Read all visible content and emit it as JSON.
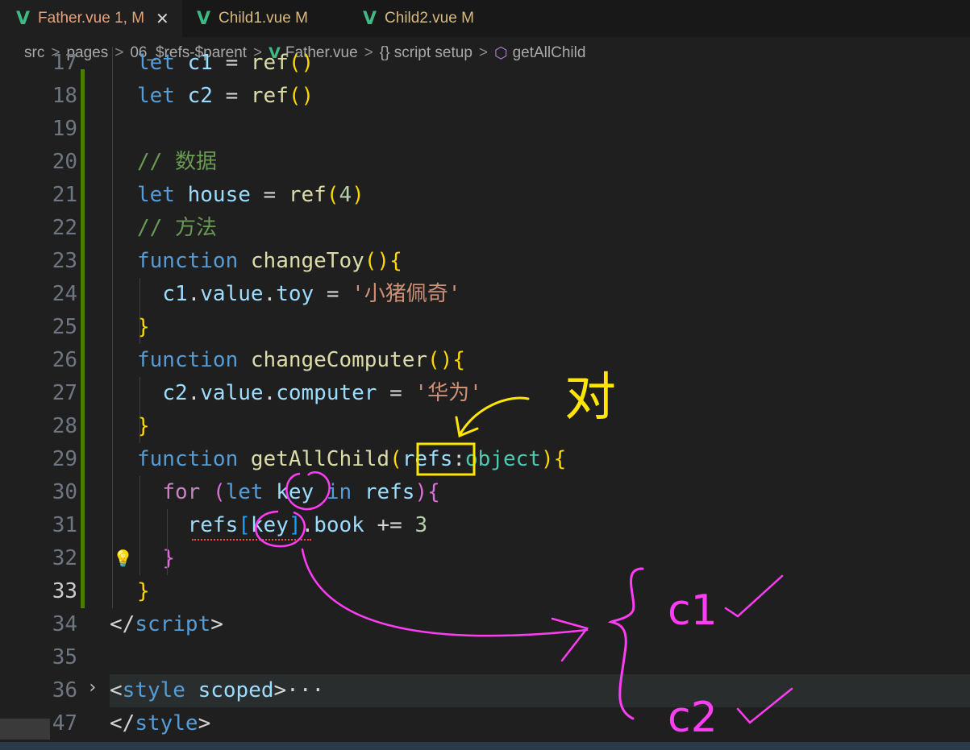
{
  "tabs": [
    {
      "label": "Father.vue 1, M",
      "active": true,
      "close": "✕"
    },
    {
      "label": "Child1.vue M"
    },
    {
      "label": "Child2.vue M"
    }
  ],
  "breadcrumb": {
    "src": "src",
    "pages": "pages",
    "folder": "06_$refs-$parent",
    "file": "Father.vue",
    "section": "{} script setup",
    "symbol": "getAllChild"
  },
  "editor": {
    "lines": [
      {
        "n": "17",
        "parts": [
          [
            "kw",
            "let"
          ],
          [
            "pun",
            " "
          ],
          [
            "var",
            "c1"
          ],
          [
            "pun",
            " = "
          ],
          [
            "fn",
            "ref"
          ],
          [
            "br1",
            "()"
          ]
        ]
      },
      {
        "n": "18",
        "parts": [
          [
            "kw",
            "let"
          ],
          [
            "pun",
            " "
          ],
          [
            "var",
            "c2"
          ],
          [
            "pun",
            " = "
          ],
          [
            "fn",
            "ref"
          ],
          [
            "br1",
            "()"
          ]
        ]
      },
      {
        "n": "19",
        "parts": []
      },
      {
        "n": "20",
        "parts": [
          [
            "cmt",
            "// 数据"
          ]
        ]
      },
      {
        "n": "21",
        "parts": [
          [
            "kw",
            "let"
          ],
          [
            "pun",
            " "
          ],
          [
            "var",
            "house"
          ],
          [
            "pun",
            " = "
          ],
          [
            "fn",
            "ref"
          ],
          [
            "br1",
            "("
          ],
          [
            "num",
            "4"
          ],
          [
            "br1",
            ")"
          ]
        ]
      },
      {
        "n": "22",
        "parts": [
          [
            "cmt",
            "// 方法"
          ]
        ]
      },
      {
        "n": "23",
        "parts": [
          [
            "kw",
            "function"
          ],
          [
            "pun",
            " "
          ],
          [
            "fn",
            "changeToy"
          ],
          [
            "br1",
            "(){"
          ]
        ]
      },
      {
        "n": "24",
        "parts": [
          [
            "pun",
            "  "
          ],
          [
            "var",
            "c1"
          ],
          [
            "pun",
            "."
          ],
          [
            "var",
            "value"
          ],
          [
            "pun",
            "."
          ],
          [
            "var",
            "toy"
          ],
          [
            "pun",
            " = "
          ],
          [
            "str",
            "'小猪佩奇'"
          ]
        ]
      },
      {
        "n": "25",
        "parts": [
          [
            "br1",
            "}"
          ]
        ]
      },
      {
        "n": "26",
        "parts": [
          [
            "kw",
            "function"
          ],
          [
            "pun",
            " "
          ],
          [
            "fn",
            "changeComputer"
          ],
          [
            "br1",
            "(){"
          ]
        ]
      },
      {
        "n": "27",
        "parts": [
          [
            "pun",
            "  "
          ],
          [
            "var",
            "c2"
          ],
          [
            "pun",
            "."
          ],
          [
            "var",
            "value"
          ],
          [
            "pun",
            "."
          ],
          [
            "var",
            "computer"
          ],
          [
            "pun",
            " = "
          ],
          [
            "str",
            "'华为'"
          ]
        ]
      },
      {
        "n": "28",
        "parts": [
          [
            "br1",
            "}"
          ]
        ]
      },
      {
        "n": "29",
        "parts": [
          [
            "kw",
            "function"
          ],
          [
            "pun",
            " "
          ],
          [
            "fn",
            "getAllChild"
          ],
          [
            "br1",
            "("
          ],
          [
            "var",
            "refs"
          ],
          [
            "pun",
            ":"
          ],
          [
            "ty",
            "object"
          ],
          [
            "br1",
            ")"
          ],
          [
            "br1",
            "{"
          ]
        ]
      },
      {
        "n": "30",
        "parts": [
          [
            "pun",
            "  "
          ],
          [
            "ctrl",
            "for"
          ],
          [
            "pun",
            " "
          ],
          [
            "br2",
            "("
          ],
          [
            "kw",
            "let"
          ],
          [
            "pun",
            " "
          ],
          [
            "var",
            "key"
          ],
          [
            "pun",
            " "
          ],
          [
            "kw",
            "in"
          ],
          [
            "pun",
            " "
          ],
          [
            "var",
            "refs"
          ],
          [
            "br2",
            ")"
          ],
          [
            "br2",
            "{"
          ]
        ]
      },
      {
        "n": "31",
        "parts": [
          [
            "pun",
            "    "
          ],
          [
            "var",
            "refs"
          ],
          [
            "br3",
            "["
          ],
          [
            "var",
            "key"
          ],
          [
            "br3",
            "]"
          ],
          [
            "pun",
            "."
          ],
          [
            "var",
            "book"
          ],
          [
            "pun",
            " += "
          ],
          [
            "num",
            "3"
          ]
        ]
      },
      {
        "n": "32",
        "parts": [
          [
            "pun",
            "  "
          ],
          [
            "br2",
            "}"
          ]
        ]
      },
      {
        "n": "33",
        "parts": [
          [
            "br1",
            "}"
          ]
        ],
        "current": true
      },
      {
        "n": "34",
        "parts": [
          [
            "pun",
            "</"
          ],
          [
            "kw",
            "script"
          ],
          [
            "pun",
            ">"
          ]
        ],
        "nomargin": true
      },
      {
        "n": "35",
        "parts": []
      },
      {
        "n": "36",
        "parts": [
          [
            "pun",
            "<"
          ],
          [
            "kw",
            "style"
          ],
          [
            "pun",
            " "
          ],
          [
            "var",
            "scoped"
          ],
          [
            "pun",
            ">"
          ],
          [
            "pun",
            "···"
          ]
        ],
        "nomargin": true,
        "folded": true
      },
      {
        "n": "47",
        "parts": [
          [
            "pun",
            "</"
          ],
          [
            "kw",
            "style"
          ],
          [
            "pun",
            ">"
          ]
        ],
        "nomargin": true
      }
    ]
  },
  "annotations": {
    "label_dui": "对",
    "label_c1": "c1",
    "label_c2": "c2",
    "color_yellow": "#ffe600",
    "color_pink": "#ff3df5"
  }
}
